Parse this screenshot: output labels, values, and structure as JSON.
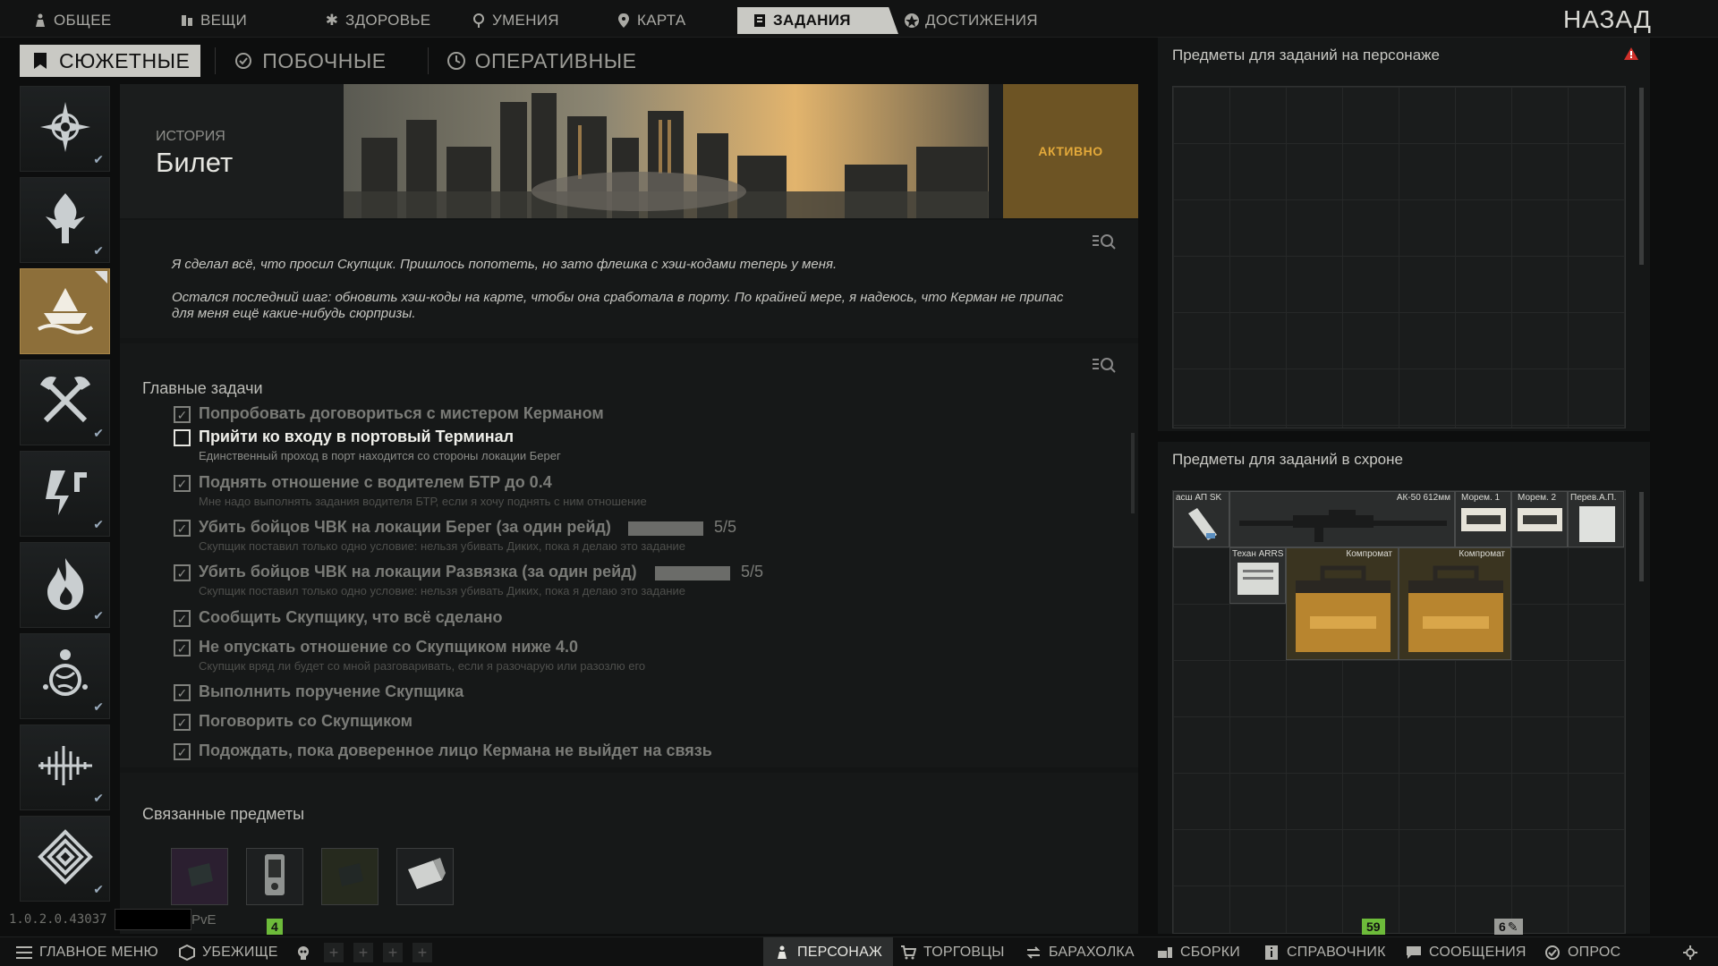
{
  "top_nav": {
    "tabs": [
      {
        "label": "ОБЩЕЕ",
        "icon": "person-icon",
        "active": false
      },
      {
        "label": "ВЕЩИ",
        "icon": "items-icon",
        "active": false
      },
      {
        "label": "ЗДОРОВЬЕ",
        "icon": "health-icon",
        "active": false
      },
      {
        "label": "УМЕНИЯ",
        "icon": "skills-icon",
        "active": false
      },
      {
        "label": "КАРТА",
        "icon": "map-pin-icon",
        "active": false
      },
      {
        "label": "ЗАДАНИЯ",
        "icon": "tasks-icon",
        "active": true
      },
      {
        "label": "ДОСТИЖЕНИЯ",
        "icon": "achievements-icon",
        "active": false
      }
    ],
    "back_label": "НАЗАД"
  },
  "sub_tabs": [
    {
      "label": "СЮЖЕТНЫЕ",
      "icon": "bookmark-icon",
      "active": true
    },
    {
      "label": "ПОБОЧНЫЕ",
      "icon": "check-circle-icon",
      "active": false
    },
    {
      "label": "ОПЕРАТИВНЫЕ",
      "icon": "clock-icon",
      "active": false
    }
  ],
  "quest_list": [
    {
      "icon": "compass-star-icon",
      "completed": true,
      "selected": false
    },
    {
      "icon": "flame-emblem-icon",
      "completed": true,
      "selected": false
    },
    {
      "icon": "ship-emblem-icon",
      "completed": false,
      "selected": true
    },
    {
      "icon": "crossed-axes-icon",
      "completed": true,
      "selected": false
    },
    {
      "icon": "lightning-icon",
      "completed": true,
      "selected": false
    },
    {
      "icon": "fire-icon",
      "completed": true,
      "selected": false
    },
    {
      "icon": "globe-person-icon",
      "completed": true,
      "selected": false
    },
    {
      "icon": "soundwave-icon",
      "completed": true,
      "selected": false
    },
    {
      "icon": "maze-icon",
      "completed": true,
      "selected": false
    }
  ],
  "quest": {
    "kind": "ИСТОРИЯ",
    "title": "Билет",
    "status": "АКТИВНО",
    "description": [
      "Я сделал всё, что просил Скупщик. Пришлось попотеть, но зато флешка с хэш-кодами теперь у меня.",
      "Остался последний шаг: обновить хэш-коды на карте, чтобы она сработала в порту. По крайней мере, я надеюсь, что Керман не припас для меня ещё какие-нибудь сюрпризы."
    ]
  },
  "objectives": {
    "header": "Главные задачи",
    "items": [
      {
        "text": "Попробовать договориться с мистером Керманом",
        "sub": "",
        "done": true
      },
      {
        "text": "Прийти ко входу в портовый Терминал",
        "sub": "Единственный проход в порт находится со стороны локации Берег",
        "done": false
      },
      {
        "text": "Поднять отношение с водителем БТР до 0.4",
        "sub": "Мне надо выполнять задания водителя БТР, если я хочу поднять с ним отношение",
        "done": true
      },
      {
        "text": "Убить бойцов ЧВК на локации Берег (за один рейд)",
        "sub": "Скупщик поставил только одно условие: нельзя убивать Диких, пока я делаю это задание",
        "done": true,
        "progress": {
          "label": "5/5",
          "fraction": 1
        }
      },
      {
        "text": "Убить бойцов ЧВК на локации Развязка (за один рейд)",
        "sub": "Скупщик поставил только одно условие: нельзя убивать Диких, пока я делаю это задание",
        "done": true,
        "progress": {
          "label": "5/5",
          "fraction": 1
        }
      },
      {
        "text": "Сообщить Скупщику, что всё сделано",
        "sub": "",
        "done": true
      },
      {
        "text": "Не опускать отношение со Скупщиком ниже 4.0",
        "sub": "Скупщик вряд ли будет со мной разговаривать, если я разочарую или разозлю его",
        "done": true
      },
      {
        "text": "Выполнить поручение Скупщика",
        "sub": "",
        "done": true
      },
      {
        "text": "Поговорить со Скупщиком",
        "sub": "",
        "done": true
      },
      {
        "text": "Подождать, пока доверенное лицо Кермана не выйдет на связь",
        "sub": "",
        "done": true
      }
    ]
  },
  "related": {
    "header": "Связанные предметы",
    "items": [
      "dark-card-icon",
      "phone-device-icon",
      "dark-flash-icon",
      "usb-stick-icon"
    ]
  },
  "right_panels": {
    "on_character_header": "Предметы для заданий на персонаже",
    "stash_header": "Предметы для заданий в схроне",
    "stash_items": [
      {
        "label": "асш АП SK"
      },
      {
        "label": "АК-50 612мм"
      },
      {
        "label": "Морем. 1"
      },
      {
        "label": "Морем. 2"
      },
      {
        "label": "Перев.А.П."
      },
      {
        "label": "Техан ARRS"
      },
      {
        "label": "Компромат"
      },
      {
        "label": "Компромат"
      }
    ]
  },
  "footer": {
    "version": "1.0.2.0.43037",
    "mode": "PvE",
    "badge_left": "4",
    "badge_mid": "59",
    "badge_right": "6"
  },
  "bottom_bar": {
    "main_menu": "ГЛАВНОЕ МЕНЮ",
    "hideout": "УБЕЖИЩЕ",
    "character": "ПЕРСОНАЖ",
    "traders": "ТОРГОВЦЫ",
    "flea": "БАРАХОЛКА",
    "builds": "СБОРКИ",
    "handbook": "СПРАВОЧНИК",
    "messages": "СООБЩЕНИЯ",
    "survey": "ОПРОС"
  },
  "colors": {
    "accent_status": "#e3a93a",
    "selected_quest": "#8d6f3a",
    "badge_green": "#6dbb3a",
    "warning": "#d0302a"
  }
}
